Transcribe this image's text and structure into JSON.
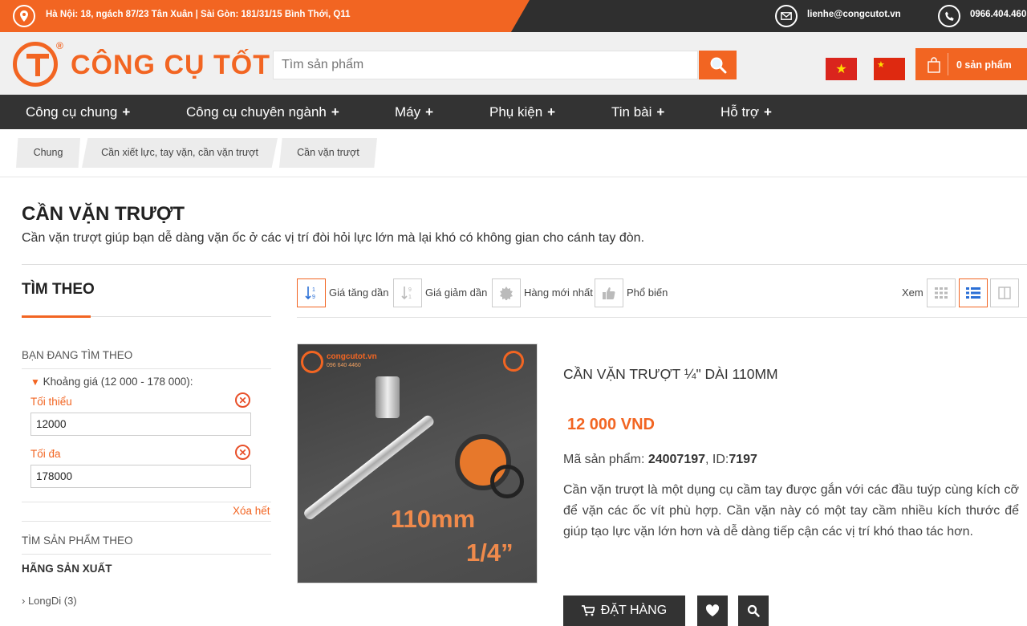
{
  "topbar": {
    "address": "Hà Nội: 18, ngách 87/23 Tân Xuân | Sài Gòn: 181/31/15 Bình Thới, Q11",
    "email": "lienhe@congcutot.vn",
    "phone": "0966.404.460"
  },
  "header": {
    "logo_text": "CÔNG CỤ TỐT",
    "logo_reg": "®",
    "search_placeholder": "Tìm sản phẩm",
    "cart_label": "0 sản phẩm"
  },
  "nav": {
    "items": [
      {
        "label": "Công cụ chung"
      },
      {
        "label": "Công cụ chuyên ngành"
      },
      {
        "label": "Máy"
      },
      {
        "label": "Phụ kiện"
      },
      {
        "label": "Tin bài"
      },
      {
        "label": "Hỗ trợ"
      }
    ],
    "plus": "+"
  },
  "breadcrumb": [
    {
      "label": "Chung"
    },
    {
      "label": "Cần xiết lực, tay vặn, cần vặn trượt"
    },
    {
      "label": "Cần vặn trượt"
    }
  ],
  "page": {
    "title": "CẦN VẶN TRƯỢT",
    "description": "Cần vặn trượt giúp bạn dễ dàng vặn ốc ở các vị trí đòi hỏi lực lớn mà lại khó có không gian cho cánh tay đòn."
  },
  "sidebar": {
    "title": "TÌM THEO",
    "current_heading": "BẠN ĐANG TÌM THEO",
    "price_filter": "Khoảng giá (12 000 - 178 000):",
    "min_label": "Tối thiểu",
    "min_value": "12000",
    "max_label": "Tối đa",
    "max_value": "178000",
    "clear_all": "Xóa hết",
    "find_heading": "TÌM SẢN PHẨM THEO",
    "brand_heading": "HÃNG SẢN XUẤT",
    "brands": [
      {
        "label": "LongDi (3)"
      }
    ]
  },
  "sortbar": {
    "options": [
      {
        "label": "Giá tăng dần",
        "icon": "sort-asc-icon"
      },
      {
        "label": "Giá giảm dần",
        "icon": "sort-desc-icon"
      },
      {
        "label": "Hàng mới nhất",
        "icon": "new-badge-icon"
      },
      {
        "label": "Phổ biến",
        "icon": "thumbs-up-icon"
      }
    ],
    "view_label": "Xem"
  },
  "product": {
    "name": "CẦN VẶN TRƯỢT ¼\" DÀI 110MM",
    "price": "12 000 VND",
    "code_label": "Mã sản phẩm: ",
    "code": "24007197",
    "id_label": ", ID:",
    "id": "7197",
    "description": "Cần vặn trượt là một dụng cụ cầm tay được gắn với các đầu tuýp cùng kích cỡ để vặn các ốc vít phù hợp. Cần vặn này có một tay cầm nhiều kích thước để giúp tạo lực vặn lớn hơn và dễ dàng tiếp cận các vị trí khó thao tác hơn.",
    "order_label": "ĐẶT HÀNG",
    "image_text": {
      "site": "congcutot.vn",
      "hotline": "096 640 4460",
      "length": "110mm",
      "size": "1/4”"
    }
  },
  "colors": {
    "accent": "#f26522",
    "dark": "#333333"
  }
}
